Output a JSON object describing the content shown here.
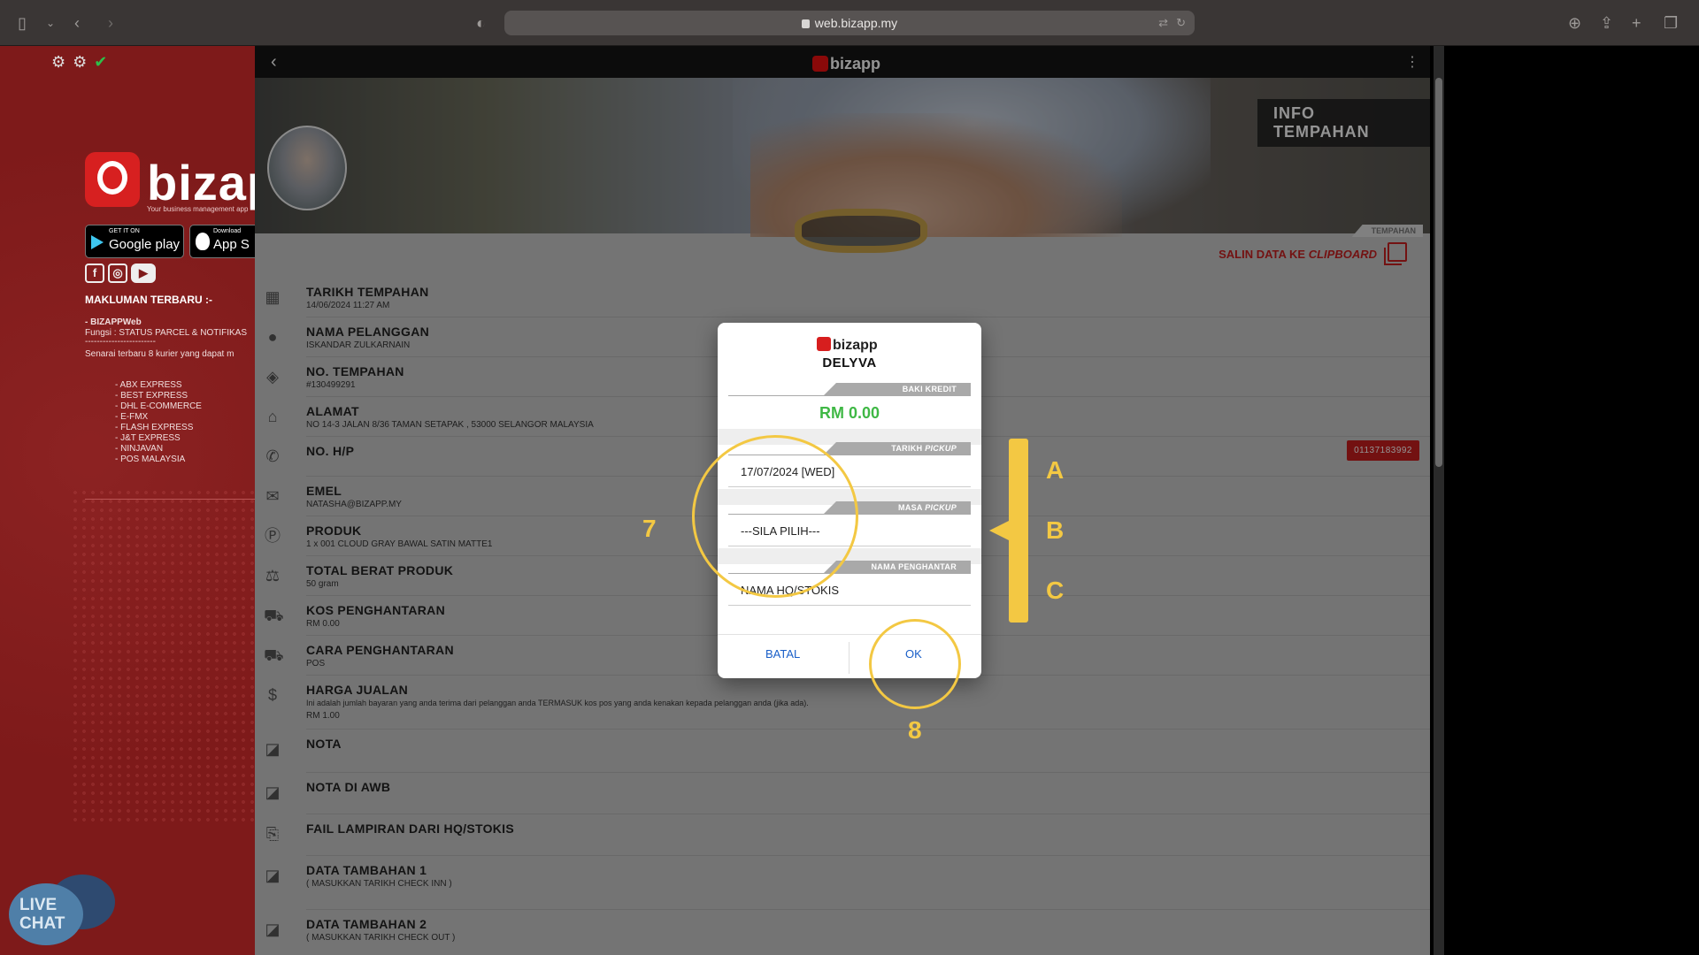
{
  "browser": {
    "url": "web.bizapp.my"
  },
  "left_panel": {
    "logo_text": "bizapp",
    "logo_sub": "Your business management app",
    "google_small": "GET IT ON",
    "google_big": "Google play",
    "apple_small": "Download",
    "apple_big": "App S",
    "announcement_title": "MAKLUMAN TERBARU :-",
    "line1": "- BIZAPPWeb",
    "line2": "Fungsi : STATUS PARCEL & NOTIFIKAS",
    "line3": "------------------------",
    "line4": "Senarai terbaru 8 kurier yang dapat m",
    "couriers": [
      "- ABX EXPRESS",
      "- BEST EXPRESS",
      "- DHL E-COMMERCE",
      "- E-FMX",
      "- FLASH EXPRESS",
      "- J&T EXPRESS",
      "- NINJAVAN",
      "- POS MALAYSIA"
    ],
    "live_chat_1": "LIVE",
    "live_chat_2": "CHAT"
  },
  "app": {
    "header_logo": "bizapp",
    "page_title": "INFO TEMPAHAN",
    "tab_label": "TEMPAHAN",
    "copy_prefix": "SALIN DATA KE ",
    "copy_italic": "CLIPBOARD",
    "phone_badge": "01137183992",
    "rows": [
      {
        "label": "TARIKH TEMPAHAN",
        "value": "14/06/2024 11:27 AM"
      },
      {
        "label": "NAMA PELANGGAN",
        "value": "ISKANDAR ZULKARNAIN"
      },
      {
        "label": "NO. TEMPAHAN",
        "value": "#130499291"
      },
      {
        "label": "ALAMAT",
        "value": "NO 14-3 JALAN 8/36 TAMAN SETAPAK , 53000 SELANGOR MALAYSIA"
      },
      {
        "label": "NO. H/P",
        "value": ""
      },
      {
        "label": "EMEL",
        "value": "NATASHA@BIZAPP.MY"
      },
      {
        "label": "PRODUK",
        "value": "1 x 001 CLOUD GRAY BAWAL SATIN MATTE1"
      },
      {
        "label": "TOTAL BERAT PRODUK",
        "value": "50 gram"
      },
      {
        "label": "KOS PENGHANTARAN",
        "value": "RM 0.00"
      },
      {
        "label": "CARA PENGHANTARAN",
        "value": "POS"
      },
      {
        "label": "HARGA JUALAN",
        "value": "Ini adalah jumlah bayaran yang anda terima dari pelanggan anda TERMASUK kos pos yang anda kenakan kepada pelanggan anda (jika ada).",
        "value2": "RM 1.00"
      },
      {
        "label": "NOTA",
        "value": ""
      },
      {
        "label": "NOTA DI AWB",
        "value": ""
      },
      {
        "label": "FAIL LAMPIRAN DARI HQ/STOKIS",
        "value": ""
      },
      {
        "label": "DATA TAMBAHAN 1",
        "value": "( MASUKKAN TARIKH CHECK INN )"
      },
      {
        "label": "DATA TAMBAHAN 2",
        "value": "( MASUKKAN TARIKH CHECK OUT )"
      }
    ]
  },
  "dialog": {
    "logo": "bizapp",
    "title": "DELYVA",
    "credit_label": "BAKI KREDIT",
    "credit_value": "RM 0.00",
    "pickup_date_label": "TARIKH ",
    "pickup_date_label_i": "PICKUP",
    "pickup_date_value": "17/07/2024 [WED]",
    "pickup_time_label": "MASA ",
    "pickup_time_label_i": "PICKUP",
    "pickup_time_value": "---SILA PILIH---",
    "sender_label": "NAMA PENGHANTAR",
    "sender_value": "NAMA HQ/STOKIS",
    "cancel_label": "BATAL",
    "ok_label": "OK"
  },
  "annotations": {
    "step7": "7",
    "step8": "8",
    "a": "A",
    "b": "B",
    "c": "C"
  },
  "colors": {
    "accent_red": "#c71f1f",
    "credit_green": "#3fb845",
    "annotation_yellow": "#f3c843",
    "link_blue": "#1a5fc8"
  }
}
